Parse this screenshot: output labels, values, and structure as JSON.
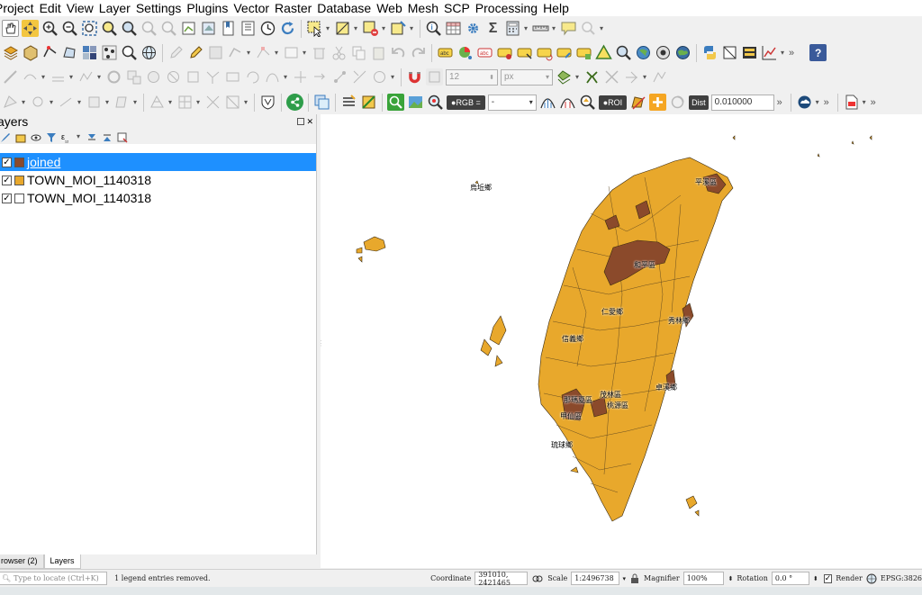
{
  "menu": [
    "Project",
    "Edit",
    "View",
    "Layer",
    "Settings",
    "Plugins",
    "Vector",
    "Raster",
    "Database",
    "Web",
    "Mesh",
    "SCP",
    "Processing",
    "Help"
  ],
  "toolbar": {
    "snap_size": "12",
    "snap_unit": "px",
    "rgb_label": "RGB =",
    "rgb_value": "-",
    "roi_label": "ROI",
    "dist_label": "Dist",
    "dist_value": "0.010000",
    "sigma": "Σ"
  },
  "layers_panel": {
    "title": "ayers",
    "layers": [
      {
        "name": "joined",
        "checked": true,
        "color": "#8b4a2b",
        "selected": true
      },
      {
        "name": "TOWN_MOI_1140318",
        "checked": true,
        "color": "#e8a82c",
        "selected": false
      },
      {
        "name": "TOWN_MOI_1140318",
        "checked": true,
        "color": "#ffffff",
        "selected": false
      }
    ],
    "tabs": [
      "rowser (2)",
      "Layers"
    ]
  },
  "map": {
    "labels": [
      {
        "text": "烏坵鄉"
      },
      {
        "text": "平溪區"
      },
      {
        "text": "和平區"
      },
      {
        "text": "仁愛鄉"
      },
      {
        "text": "秀林鄉"
      },
      {
        "text": "信義鄉"
      },
      {
        "text": "卓溪鄉"
      },
      {
        "text": "茂林區"
      },
      {
        "text": "桃源區"
      },
      {
        "text": "那瑪夏區"
      },
      {
        "text": "甲仙區"
      },
      {
        "text": "琉球鄉"
      }
    ],
    "colors": {
      "land": "#e8a82c",
      "joined": "#8b4a2b",
      "outline": "#4a3a1a"
    }
  },
  "status": {
    "locator_placeholder": "Type to locate (Ctrl+K)",
    "message": "1 legend entries removed.",
    "coordinate_label": "Coordinate",
    "coordinate_value": "391010, 2421465",
    "scale_label": "Scale",
    "scale_value": "1:2496738",
    "magnifier_label": "Magnifier",
    "magnifier_value": "100%",
    "rotation_label": "Rotation",
    "rotation_value": "0.0 °",
    "render_label": "Render",
    "crs": "EPSG:3826"
  }
}
